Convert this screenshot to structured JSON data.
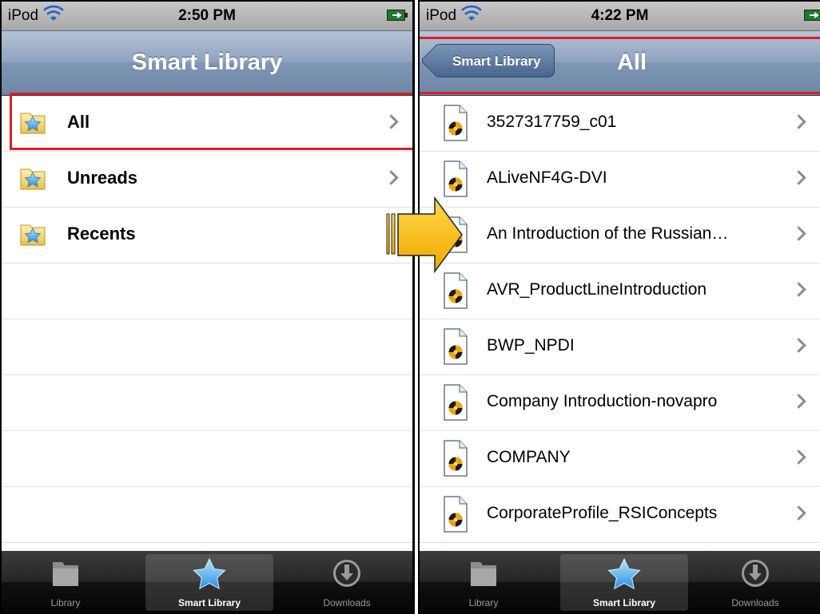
{
  "left_screen": {
    "status": {
      "carrier": "iPod",
      "time": "2:50 PM"
    },
    "nav_title": "Smart Library",
    "rows": [
      {
        "label": "All",
        "icon": "folder-star-icon"
      },
      {
        "label": "Unreads",
        "icon": "folder-star-icon"
      },
      {
        "label": "Recents",
        "icon": "folder-star-icon"
      }
    ],
    "tabs": [
      {
        "label": "Library",
        "icon": "folder-icon"
      },
      {
        "label": "Smart Library",
        "icon": "star-icon",
        "selected": true
      },
      {
        "label": "Downloads",
        "icon": "download-icon"
      }
    ]
  },
  "right_screen": {
    "status": {
      "carrier": "iPod",
      "time": "4:22 PM"
    },
    "back_button": "Smart Library",
    "nav_title": "All",
    "rows": [
      {
        "label": "3527317759_c01",
        "icon": "pdf-document-icon"
      },
      {
        "label": "ALiveNF4G-DVI",
        "icon": "pdf-document-icon"
      },
      {
        "label": "An Introduction of the Russian…",
        "icon": "pdf-document-icon"
      },
      {
        "label": "AVR_ProductLineIntroduction",
        "icon": "pdf-document-icon"
      },
      {
        "label": "BWP_NPDI",
        "icon": "pdf-document-icon"
      },
      {
        "label": "Company Introduction-novapro",
        "icon": "pdf-document-icon"
      },
      {
        "label": "COMPANY",
        "icon": "pdf-document-icon"
      },
      {
        "label": "CorporateProfile_RSIConcepts",
        "icon": "pdf-document-icon"
      }
    ],
    "tabs": [
      {
        "label": "Library",
        "icon": "folder-icon"
      },
      {
        "label": "Smart Library",
        "icon": "star-icon",
        "selected": true
      },
      {
        "label": "Downloads",
        "icon": "download-icon"
      }
    ]
  },
  "colors": {
    "highlight": "#e31b23",
    "arrow": "#f5b400",
    "nav_bar": "#7f96b4"
  }
}
